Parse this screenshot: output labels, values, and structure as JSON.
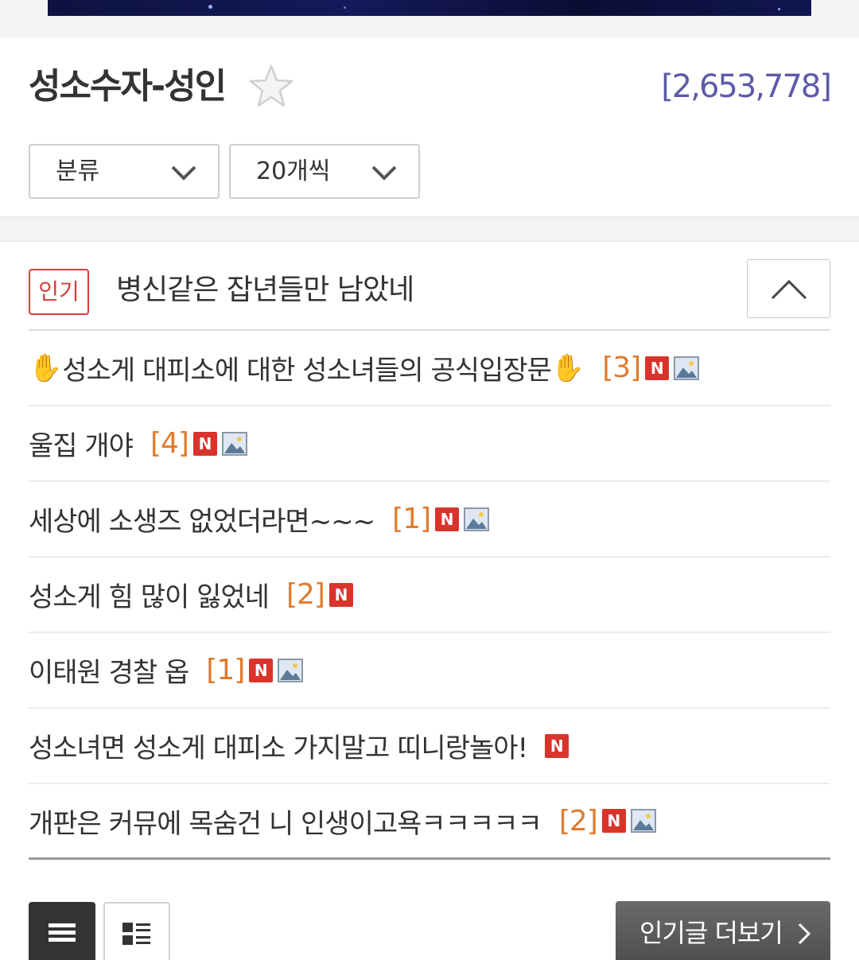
{
  "board": {
    "title": "성소수자-성인",
    "total_count": "[2,653,778]"
  },
  "filters": {
    "category": "분류",
    "per_page": "20개씩"
  },
  "popular": {
    "badge": "인기",
    "title": "병신같은 잡년들만 남았네",
    "posts": [
      {
        "prefix": "✋",
        "title": "성소게 대피소에 대한 성소녀들의 공식입장문",
        "suffix": "✋",
        "replies": "[3]",
        "new": "N",
        "has_image": true
      },
      {
        "prefix": "",
        "title": "울집 개야",
        "suffix": "",
        "replies": "[4]",
        "new": "N",
        "has_image": true
      },
      {
        "prefix": "",
        "title": "세상에 소생즈 없었더라면~~~",
        "suffix": "",
        "replies": "[1]",
        "new": "N",
        "has_image": true
      },
      {
        "prefix": "",
        "title": "성소게 힘 많이 잃었네",
        "suffix": "",
        "replies": "[2]",
        "new": "N",
        "has_image": false
      },
      {
        "prefix": "",
        "title": "이태원 경찰 옵",
        "suffix": "",
        "replies": "[1]",
        "new": "N",
        "has_image": true
      },
      {
        "prefix": "",
        "title": "성소녀면 성소게 대피소 가지말고 띠니랑놀아!",
        "suffix": "",
        "replies": "",
        "new": "N",
        "has_image": false
      },
      {
        "prefix": "",
        "title": "개판은 커뮤에 목숨건 니 인생이고욕ㅋㅋㅋㅋㅋ",
        "suffix": "",
        "replies": "[2]",
        "new": "N",
        "has_image": true
      }
    ]
  },
  "footer": {
    "more_label": "인기글 더보기"
  },
  "icons": {
    "favorite": "star-icon",
    "collapse": "chevron-up-icon",
    "dropdown": "chevron-down-icon",
    "image": "image-icon",
    "list_view": "list-view-icon",
    "card_view": "card-view-icon",
    "more": "chevron-right-icon"
  },
  "colors": {
    "count": "#5f5aa8",
    "popular_badge": "#d43f3a",
    "reply_count": "#e07b2e",
    "new_badge": "#d9342b"
  }
}
